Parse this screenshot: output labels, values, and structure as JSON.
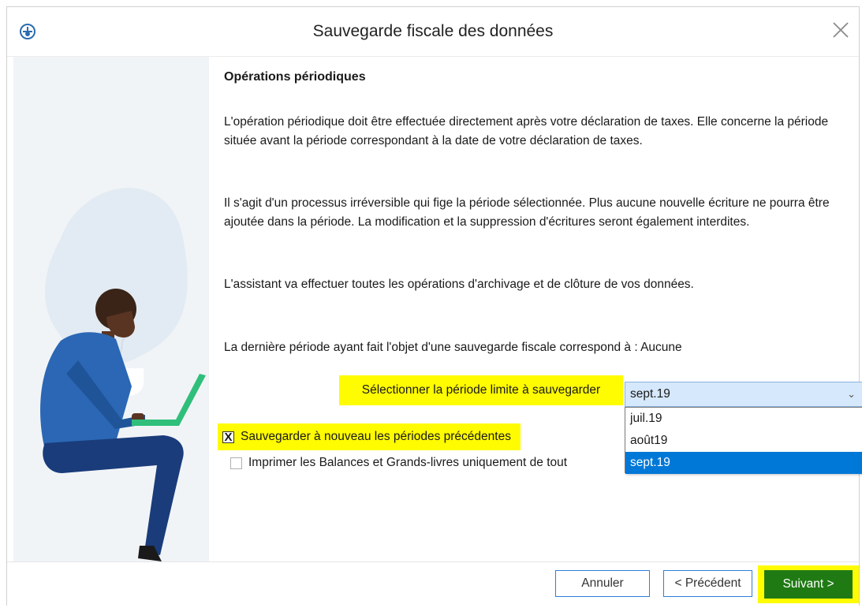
{
  "window": {
    "title": "Sauvegarde fiscale des données"
  },
  "content": {
    "heading": "Opérations périodiques",
    "paragraph1": "L'opération périodique doit être effectuée directement après votre déclaration de taxes. Elle concerne la période située avant la période correspondant à la date de votre déclaration de taxes.",
    "paragraph2": "Il s'agit d'un processus irréversible qui fige la période sélectionnée. Plus aucune nouvelle écriture ne pourra être ajoutée dans la période. La modification et la suppression d'écritures seront également interdites.",
    "paragraph3": "L'assistant va effectuer toutes les opérations d'archivage et de clôture de vos données.",
    "paragraph4": "La dernière période ayant fait l'objet d'une sauvegarde fiscale correspond à : Aucune"
  },
  "period_select": {
    "label": "Sélectionner la période limite à sauvegarder",
    "value": "sept.19",
    "options": [
      "juil.19",
      "août19",
      "sept.19"
    ]
  },
  "checkboxes": {
    "resave_label": "Sauvegarder à nouveau les périodes précédentes",
    "resave_mark": "X",
    "print_label": "Imprimer les Balances et Grands-livres uniquement de tout"
  },
  "footer": {
    "cancel": "Annuler",
    "previous": "< Précédent",
    "next": "Suivant >"
  },
  "colors": {
    "highlight": "#fffb00",
    "next_button": "#1f7a14",
    "accent_blue": "#0078d7",
    "illustration_bg": "#f1f4f7"
  }
}
